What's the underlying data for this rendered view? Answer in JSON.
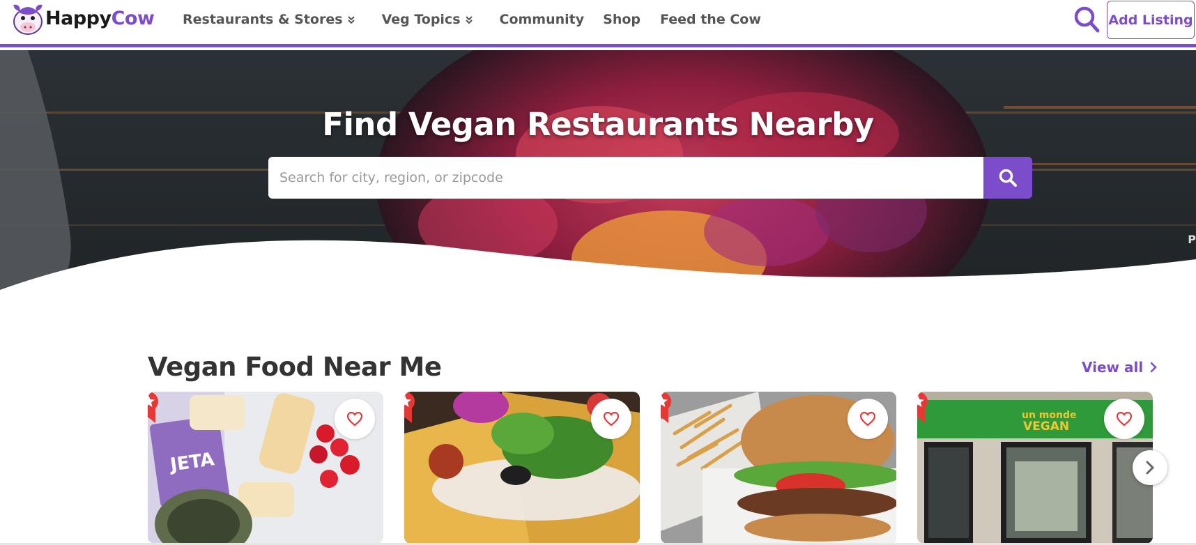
{
  "brand": {
    "logo_happy": "Happy",
    "logo_cow": "Cow",
    "accent": "#7c4dcb",
    "ribbon_color": "#e53935",
    "heart_color": "#e53935"
  },
  "nav": {
    "items": [
      {
        "label": "Restaurants & Stores",
        "dropdown": true
      },
      {
        "label": "Veg Topics",
        "dropdown": true
      },
      {
        "label": "Community",
        "dropdown": false
      },
      {
        "label": "Shop",
        "dropdown": false
      },
      {
        "label": "Feed the Cow",
        "dropdown": false
      }
    ],
    "search_icon": "search-icon",
    "add_listing": "Add Listing"
  },
  "hero": {
    "title": "Find Vegan Restaurants Nearby",
    "search_placeholder": "Search for city, region, or zipcode",
    "search_button_icon": "search-icon",
    "edge_letter": "P"
  },
  "section": {
    "title": "Vegan Food Near Me",
    "view_all": "View all",
    "cards": [
      {
        "image": "bread-and-tomatoes-photo",
        "sign_text": "JETA",
        "badge": "star-ribbon-icon",
        "favorite": "heart-icon"
      },
      {
        "image": "nachos-photo",
        "badge": "star-ribbon-icon",
        "favorite": "heart-icon"
      },
      {
        "image": "burger-and-fries-photo",
        "badge": "star-ribbon-icon",
        "favorite": "heart-icon"
      },
      {
        "image": "un-monde-vegan-storefront-photo",
        "sign_text_1": "un monde",
        "sign_text_2": "VEGAN",
        "badge": "star-ribbon-icon",
        "favorite": "heart-icon"
      }
    ],
    "next_icon": "chevron-right-icon"
  }
}
